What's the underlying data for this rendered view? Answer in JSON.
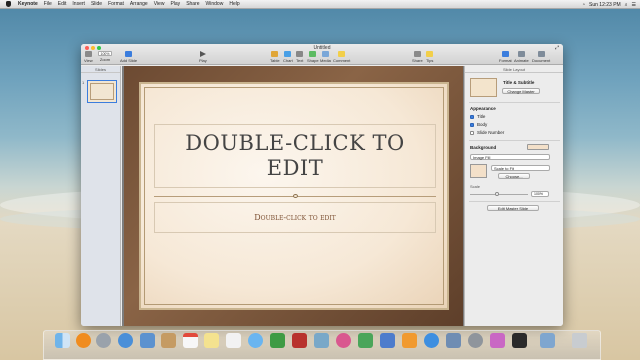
{
  "menubar": {
    "app": "Keynote",
    "items": [
      "File",
      "Edit",
      "Insert",
      "Slide",
      "Format",
      "Arrange",
      "View",
      "Play",
      "Share",
      "Window",
      "Help"
    ],
    "clock": "Sun 12:23 PM"
  },
  "window": {
    "title": "Untitled",
    "toolbar": {
      "view": "View",
      "zoom_value": "100%",
      "zoom": "Zoom",
      "add_slide": "Add Slide",
      "play": "Play",
      "table": "Table",
      "chart": "Chart",
      "text": "Text",
      "shape": "Shape",
      "media": "Media",
      "comment": "Comment",
      "share": "Share",
      "tips": "Tips",
      "format": "Format",
      "animate": "Animate",
      "document": "Document"
    }
  },
  "slides_panel": {
    "header": "Slides",
    "number": "1"
  },
  "slide": {
    "title": "DOUBLE-CLICK TO EDIT",
    "subtitle": "Double-click to edit"
  },
  "inspector": {
    "header": "Slide Layout",
    "layout_name": "Title & Subtitle",
    "change_master": "Change Master",
    "appearance": "Appearance",
    "title_check": "Title",
    "body_check": "Body",
    "slide_number_check": "Slide Number",
    "background": "Background",
    "fill_type": "Image Fill",
    "scale_mode": "Scale to Fit",
    "choose": "Choose...",
    "scale_label": "Scale",
    "scale_value": "100%",
    "edit_master": "Edit Master Slide"
  },
  "colors": {
    "accent": "#3b7ddd",
    "slide_frame": "#6c4a32",
    "slide_paper": "#f6e8d6"
  }
}
